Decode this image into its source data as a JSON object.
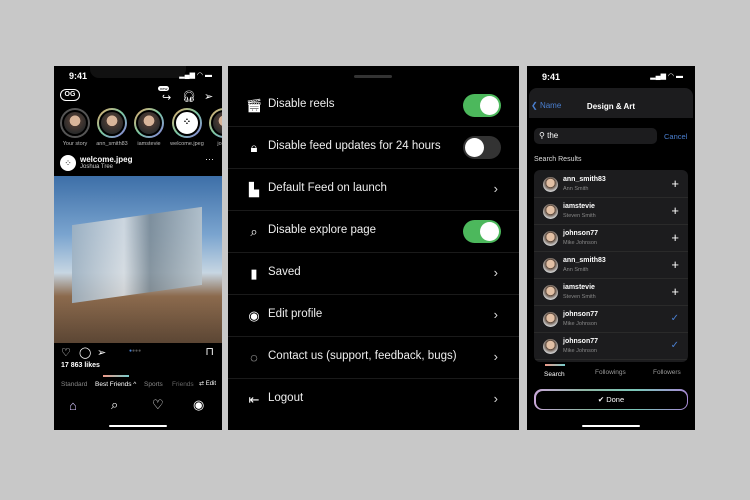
{
  "feed": {
    "time": "9:41",
    "logo": "OG",
    "new_badge": "new",
    "stories": [
      {
        "label": "Your story"
      },
      {
        "label": "ann_smith83"
      },
      {
        "label": "iamstevie"
      },
      {
        "label": "welcome.jpeg"
      },
      {
        "label": "johns"
      }
    ],
    "post": {
      "user": "welcome.jpeg",
      "location": "Joshua Tree",
      "likes": "17 863 likes"
    },
    "feed_tabs": [
      "Standard",
      "Best Friends ^",
      "Sports",
      "Friends"
    ],
    "edit_label": "Edit",
    "nav_icons": [
      "home-icon",
      "search-icon",
      "heart-icon",
      "profile-icon"
    ]
  },
  "settings": {
    "items": [
      {
        "label": "Disable reels",
        "icon": "reels-icon",
        "control": "toggle",
        "on": true
      },
      {
        "label": "Disable feed updates for 24 hours",
        "icon": "lock-icon",
        "control": "toggle",
        "on": false
      },
      {
        "label": "Default Feed on launch",
        "icon": "bars-icon",
        "control": "chevron"
      },
      {
        "label": "Disable explore page",
        "icon": "search-icon",
        "control": "toggle",
        "on": true
      },
      {
        "label": "Saved",
        "icon": "bookmark-icon",
        "control": "chevron"
      },
      {
        "label": "Edit profile",
        "icon": "profile-icon",
        "control": "chevron"
      },
      {
        "label": "Contact us (support, feedback, bugs)",
        "icon": "headset-icon",
        "control": "chevron"
      },
      {
        "label": "Logout",
        "icon": "logout-icon",
        "control": "chevron"
      }
    ],
    "toggle_on_color": "#4cb85c"
  },
  "search": {
    "time": "9:41",
    "back_label": "Name",
    "title": "Design & Art",
    "query": "the",
    "cancel": "Cancel",
    "section": "Search Results",
    "results": [
      {
        "username": "ann_smith83",
        "name": "Ann Smith",
        "added": false
      },
      {
        "username": "iamstevie",
        "name": "Steven Smith",
        "added": false
      },
      {
        "username": "johnson77",
        "name": "Mike Johnson",
        "added": false
      },
      {
        "username": "ann_smith83",
        "name": "Ann Smith",
        "added": false
      },
      {
        "username": "iamstevie",
        "name": "Steven Smith",
        "added": false
      },
      {
        "username": "johnson77",
        "name": "Mike Johnson",
        "added": true
      },
      {
        "username": "johnson77",
        "name": "Mike Johnson",
        "added": true
      }
    ],
    "tabs": [
      "Search",
      "Followings",
      "Followers"
    ],
    "done": "Done",
    "accent": "#4a7fd0"
  }
}
